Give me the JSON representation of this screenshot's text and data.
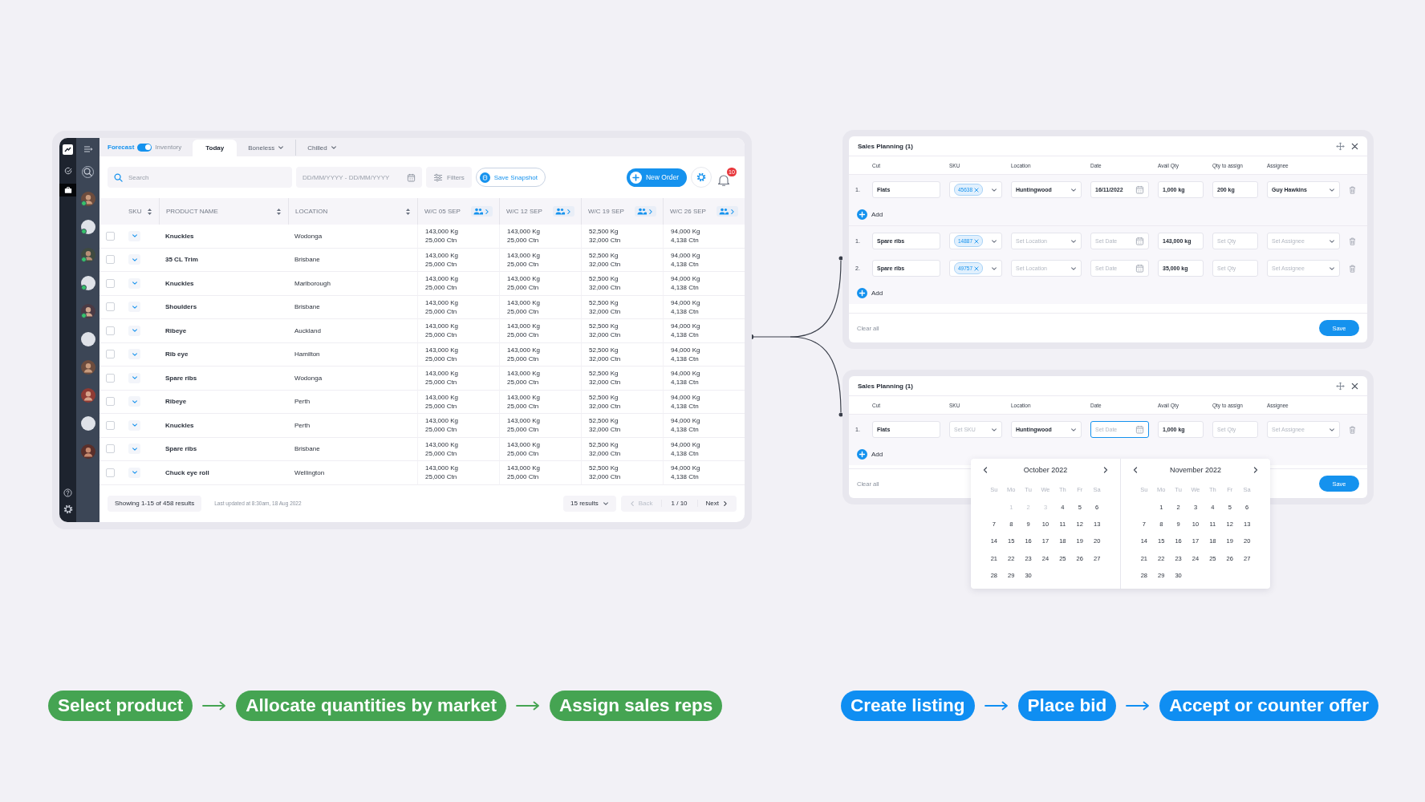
{
  "inventory_app": {
    "rail": [
      {
        "kind": "check",
        "selected": false
      },
      {
        "kind": "briefcase",
        "selected": true
      }
    ],
    "avatars": [
      {
        "kind": "photo",
        "online": true
      },
      {
        "kind": "plain",
        "online": true
      },
      {
        "kind": "photo",
        "online": true
      },
      {
        "kind": "plain",
        "online": true
      },
      {
        "kind": "photo",
        "online": true
      },
      {
        "kind": "plain",
        "online": false
      },
      {
        "kind": "photo",
        "online": false
      },
      {
        "kind": "photo",
        "online": false
      },
      {
        "kind": "plain",
        "online": false
      },
      {
        "kind": "photo",
        "online": false
      }
    ],
    "view_toggle": {
      "left_label": "Forecast",
      "right_label": "Inventory",
      "on": true
    },
    "tabs": [
      {
        "label": "Today",
        "selected": true,
        "dropdown": false
      },
      {
        "label": "Boneless",
        "selected": false,
        "dropdown": true
      },
      {
        "label": "Chilled",
        "selected": false,
        "dropdown": true
      }
    ],
    "search": {
      "placeholder": "Search"
    },
    "date_range": {
      "placeholder": "DD/MM/YYYY - DD/MM/YYYY"
    },
    "filters_button": "Filters",
    "snapshot_button": "Save Snapshot",
    "new_order_button": "New Order",
    "notification_count": "10",
    "table": {
      "columns": [
        {
          "label": "SKU",
          "kind": "sort"
        },
        {
          "label": "PRODUCT NAME",
          "kind": "sort"
        },
        {
          "label": "LOCATION",
          "kind": "sort"
        },
        {
          "label": "W/C 05 SEP",
          "kind": "week"
        },
        {
          "label": "W/C 12 SEP",
          "kind": "week"
        },
        {
          "label": "W/C 19 SEP",
          "kind": "week"
        },
        {
          "label": "W/C 26 SEP",
          "kind": "week"
        }
      ],
      "rows": [
        {
          "checked": false,
          "product": "Knuckles",
          "location": "Wodonga",
          "weeks": [
            {
              "kg": "143,000 Kg",
              "ctn": "25,000 Ctn"
            },
            {
              "kg": "143,000 Kg",
              "ctn": "25,000 Ctn"
            },
            {
              "kg": "52,500 Kg",
              "ctn": "32,000 Ctn"
            },
            {
              "kg": "94,000 Kg",
              "ctn": "4,138 Ctn"
            }
          ]
        },
        {
          "checked": false,
          "product": "35 CL Trim",
          "location": "Brisbane",
          "weeks": [
            {
              "kg": "143,000 Kg",
              "ctn": "25,000 Ctn"
            },
            {
              "kg": "143,000 Kg",
              "ctn": "25,000 Ctn"
            },
            {
              "kg": "52,500 Kg",
              "ctn": "32,000 Ctn"
            },
            {
              "kg": "94,000 Kg",
              "ctn": "4,138 Ctn"
            }
          ]
        },
        {
          "checked": false,
          "product": "Knuckles",
          "location": "Marlborough",
          "weeks": [
            {
              "kg": "143,000 Kg",
              "ctn": "25,000 Ctn"
            },
            {
              "kg": "143,000 Kg",
              "ctn": "25,000 Ctn"
            },
            {
              "kg": "52,500 Kg",
              "ctn": "32,000 Ctn"
            },
            {
              "kg": "94,000 Kg",
              "ctn": "4,138 Ctn"
            }
          ]
        },
        {
          "checked": false,
          "product": "Shoulders",
          "location": "Brisbane",
          "weeks": [
            {
              "kg": "143,000 Kg",
              "ctn": "25,000 Ctn"
            },
            {
              "kg": "143,000 Kg",
              "ctn": "25,000 Ctn"
            },
            {
              "kg": "52,500 Kg",
              "ctn": "32,000 Ctn"
            },
            {
              "kg": "94,000 Kg",
              "ctn": "4,138 Ctn"
            }
          ]
        },
        {
          "checked": false,
          "product": "Ribeye",
          "location": "Auckland",
          "weeks": [
            {
              "kg": "143,000 Kg",
              "ctn": "25,000 Ctn"
            },
            {
              "kg": "143,000 Kg",
              "ctn": "25,000 Ctn"
            },
            {
              "kg": "52,500 Kg",
              "ctn": "32,000 Ctn"
            },
            {
              "kg": "94,000 Kg",
              "ctn": "4,138 Ctn"
            }
          ]
        },
        {
          "checked": false,
          "product": "Rib eye",
          "location": "Hamilton",
          "weeks": [
            {
              "kg": "143,000 Kg",
              "ctn": "25,000 Ctn"
            },
            {
              "kg": "143,000 Kg",
              "ctn": "25,000 Ctn"
            },
            {
              "kg": "52,500 Kg",
              "ctn": "32,000 Ctn"
            },
            {
              "kg": "94,000 Kg",
              "ctn": "4,138 Ctn"
            }
          ]
        },
        {
          "checked": false,
          "product": "Spare ribs",
          "location": "Wodonga",
          "weeks": [
            {
              "kg": "143,000 Kg",
              "ctn": "25,000 Ctn"
            },
            {
              "kg": "143,000 Kg",
              "ctn": "25,000 Ctn"
            },
            {
              "kg": "52,500 Kg",
              "ctn": "32,000 Ctn"
            },
            {
              "kg": "94,000 Kg",
              "ctn": "4,138 Ctn"
            }
          ]
        },
        {
          "checked": false,
          "product": "Ribeye",
          "location": "Perth",
          "weeks": [
            {
              "kg": "143,000 Kg",
              "ctn": "25,000 Ctn"
            },
            {
              "kg": "143,000 Kg",
              "ctn": "25,000 Ctn"
            },
            {
              "kg": "52,500 Kg",
              "ctn": "32,000 Ctn"
            },
            {
              "kg": "94,000 Kg",
              "ctn": "4,138 Ctn"
            }
          ]
        },
        {
          "checked": false,
          "product": "Knuckles",
          "location": "Perth",
          "weeks": [
            {
              "kg": "143,000 Kg",
              "ctn": "25,000 Ctn"
            },
            {
              "kg": "143,000 Kg",
              "ctn": "25,000 Ctn"
            },
            {
              "kg": "52,500 Kg",
              "ctn": "32,000 Ctn"
            },
            {
              "kg": "94,000 Kg",
              "ctn": "4,138 Ctn"
            }
          ]
        },
        {
          "checked": false,
          "product": "Spare ribs",
          "location": "Brisbane",
          "weeks": [
            {
              "kg": "143,000 Kg",
              "ctn": "25,000 Ctn"
            },
            {
              "kg": "143,000 Kg",
              "ctn": "25,000 Ctn"
            },
            {
              "kg": "52,500 Kg",
              "ctn": "32,000 Ctn"
            },
            {
              "kg": "94,000 Kg",
              "ctn": "4,138 Ctn"
            }
          ]
        },
        {
          "checked": false,
          "product": "Chuck eye roll",
          "location": "Wellington",
          "weeks": [
            {
              "kg": "143,000 Kg",
              "ctn": "25,000 Ctn"
            },
            {
              "kg": "143,000 Kg",
              "ctn": "25,000 Ctn"
            },
            {
              "kg": "52,500 Kg",
              "ctn": "32,000 Ctn"
            },
            {
              "kg": "94,000 Kg",
              "ctn": "4,138 Ctn"
            }
          ]
        }
      ]
    },
    "footer": {
      "summary": "Showing 1-15 of 458 results",
      "last_updated": "Last updated at 8:30am, 18 Aug 2022",
      "page_size": "15 results",
      "back": {
        "label": "Back",
        "disabled": true
      },
      "page": "1 / 10",
      "next": {
        "label": "Next",
        "disabled": false
      }
    }
  },
  "sales_panels": [
    {
      "title": "Sales Planning (1)",
      "columns": [
        "Cut",
        "SKU",
        "Location",
        "Date",
        "Avail Qty",
        "Qty to assign",
        "Assignee"
      ],
      "groups": [
        {
          "rows": [
            {
              "number": "1.",
              "cut": "Flats",
              "sku": {
                "tag": "45638"
              },
              "location": {
                "value": "Huntingwood"
              },
              "date": {
                "value": "16/11/2022",
                "focused": false
              },
              "avail_qty": "1,000 kg",
              "qty": {
                "value": "200 kg"
              },
              "assignee": {
                "value": "Guy Hawkins"
              }
            }
          ],
          "add": "Add"
        },
        {
          "rows": [
            {
              "number": "1.",
              "cut": "Spare ribs",
              "sku": {
                "tag": "14887"
              },
              "location": {
                "placeholder": "Set Location"
              },
              "date": {
                "placeholder": "Set Date",
                "focused": false
              },
              "avail_qty": "143,000 kg",
              "qty": {
                "placeholder": "Set Qty"
              },
              "assignee": {
                "placeholder": "Set Assignee"
              }
            },
            {
              "number": "2.",
              "cut": "Spare ribs",
              "sku": {
                "tag": "49757"
              },
              "location": {
                "placeholder": "Set Location"
              },
              "date": {
                "placeholder": "Set Date",
                "focused": false
              },
              "avail_qty": "35,000 kg",
              "qty": {
                "placeholder": "Set Qty"
              },
              "assignee": {
                "placeholder": "Set Assignee"
              }
            }
          ],
          "add": "Add"
        }
      ],
      "clear": "Clear all",
      "save": "Save"
    },
    {
      "title": "Sales Planning (1)",
      "columns": [
        "Cut",
        "SKU",
        "Location",
        "Date",
        "Avail Qty",
        "Qty to assign",
        "Assignee"
      ],
      "groups": [
        {
          "rows": [
            {
              "number": "1.",
              "cut": "Flats",
              "sku": {
                "placeholder": "Set SKU"
              },
              "location": {
                "value": "Huntingwood"
              },
              "date": {
                "placeholder": "Set Date",
                "focused": true
              },
              "avail_qty": "1,000 kg",
              "qty": {
                "placeholder": "Set Qty"
              },
              "assignee": {
                "placeholder": "Set Assignee"
              }
            }
          ],
          "add": "Add"
        }
      ],
      "clear": "Clear all",
      "save": "Save"
    }
  ],
  "date_picker": {
    "months": [
      {
        "title": "October 2022",
        "weekdays": [
          "Su",
          "Mo",
          "Tu",
          "We",
          "Th",
          "Fr",
          "Sa"
        ],
        "weeks": [
          {
            "days": [
              {
                "day": "1",
                "muted": true
              },
              {
                "day": "2",
                "muted": true
              },
              {
                "day": "3",
                "muted": true
              },
              {
                "day": "4",
                "muted": false
              },
              {
                "day": "5",
                "muted": false
              },
              {
                "day": "6",
                "muted": false
              }
            ]
          },
          {
            "days": [
              {
                "day": "7",
                "muted": false
              },
              {
                "day": "8",
                "muted": false
              },
              {
                "day": "9",
                "muted": false
              },
              {
                "day": "10",
                "muted": false
              },
              {
                "day": "11",
                "muted": false
              },
              {
                "day": "12",
                "muted": false
              },
              {
                "day": "13",
                "muted": false
              }
            ]
          },
          {
            "days": [
              {
                "day": "14",
                "muted": false
              },
              {
                "day": "15",
                "muted": false
              },
              {
                "day": "16",
                "muted": false
              },
              {
                "day": "17",
                "muted": false
              },
              {
                "day": "18",
                "muted": false
              },
              {
                "day": "19",
                "muted": false
              },
              {
                "day": "20",
                "muted": false
              }
            ]
          },
          {
            "days": [
              {
                "day": "21",
                "muted": false
              },
              {
                "day": "22",
                "muted": false
              },
              {
                "day": "23",
                "muted": false
              },
              {
                "day": "24",
                "muted": false
              },
              {
                "day": "25",
                "muted": false
              },
              {
                "day": "26",
                "muted": false
              },
              {
                "day": "27",
                "muted": false
              }
            ]
          },
          {
            "days": [
              {
                "day": "28",
                "muted": false
              },
              {
                "day": "29",
                "muted": false
              },
              {
                "day": "30",
                "muted": false
              }
            ]
          }
        ]
      },
      {
        "title": "November 2022",
        "weekdays": [
          "Su",
          "Mo",
          "Tu",
          "We",
          "Th",
          "Fr",
          "Sa"
        ],
        "weeks": [
          {
            "days": [
              {
                "day": "1",
                "muted": false
              },
              {
                "day": "2",
                "muted": false
              },
              {
                "day": "3",
                "muted": false
              },
              {
                "day": "4",
                "muted": false
              },
              {
                "day": "5",
                "muted": false
              },
              {
                "day": "6",
                "muted": false
              }
            ]
          },
          {
            "days": [
              {
                "day": "7",
                "muted": false
              },
              {
                "day": "8",
                "muted": false
              },
              {
                "day": "9",
                "muted": false
              },
              {
                "day": "10",
                "muted": false
              },
              {
                "day": "11",
                "muted": false
              },
              {
                "day": "12",
                "muted": false
              },
              {
                "day": "13",
                "muted": false
              }
            ]
          },
          {
            "days": [
              {
                "day": "14",
                "muted": false
              },
              {
                "day": "15",
                "muted": false
              },
              {
                "day": "16",
                "muted": false
              },
              {
                "day": "17",
                "muted": false
              },
              {
                "day": "18",
                "muted": false
              },
              {
                "day": "19",
                "muted": false
              },
              {
                "day": "20",
                "muted": false
              }
            ]
          },
          {
            "days": [
              {
                "day": "21",
                "muted": false
              },
              {
                "day": "22",
                "muted": false
              },
              {
                "day": "23",
                "muted": false
              },
              {
                "day": "24",
                "muted": false
              },
              {
                "day": "25",
                "muted": false
              },
              {
                "day": "26",
                "muted": false
              },
              {
                "day": "27",
                "muted": false
              }
            ]
          },
          {
            "days": [
              {
                "day": "28",
                "muted": false
              },
              {
                "day": "29",
                "muted": false
              },
              {
                "day": "30",
                "muted": false
              }
            ]
          }
        ]
      }
    ]
  },
  "flows": [
    {
      "color": "#45a452",
      "steps": [
        "Select product",
        "Allocate quantities by market",
        "Assign sales reps"
      ]
    },
    {
      "color": "#0f8ef2",
      "steps": [
        "Create listing",
        "Place bid",
        "Accept or counter offer"
      ]
    }
  ]
}
